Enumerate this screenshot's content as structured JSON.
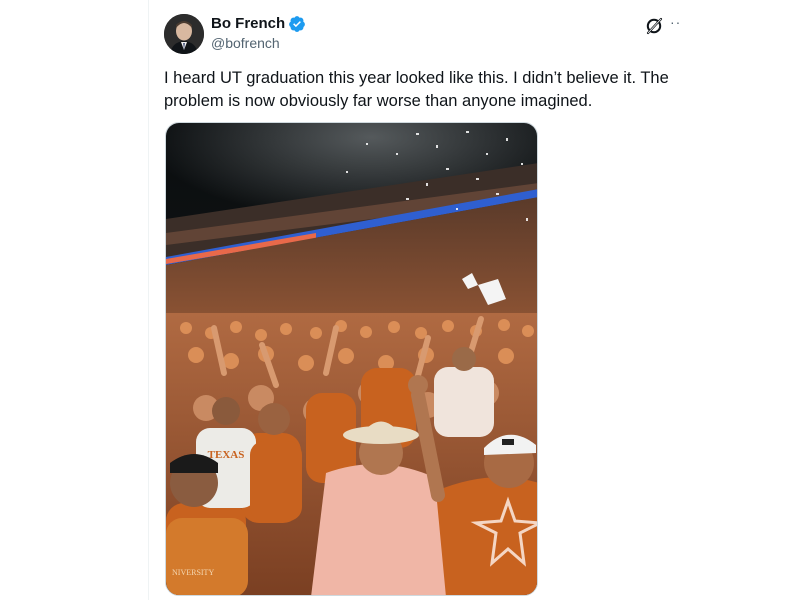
{
  "tweet": {
    "author": {
      "display_name": "Bo French",
      "handle": "@bofrench",
      "verified": true
    },
    "text": "I heard UT graduation this year looked like this. I didn’t believe it. The problem is now obviously far worse than anyone imagined.",
    "media": {
      "type": "photo",
      "shirt_text": "TEXAS",
      "corner_text": "NIVERSITY"
    },
    "actions": {
      "grok_icon": "grok-icon",
      "more_icon": "more-icon",
      "more_label": "··"
    }
  },
  "colors": {
    "text_primary": "#0f1419",
    "text_secondary": "#536471",
    "verified_blue": "#1d9bf0",
    "burnt_orange": "#c8621f",
    "border": "#cfd9de"
  }
}
